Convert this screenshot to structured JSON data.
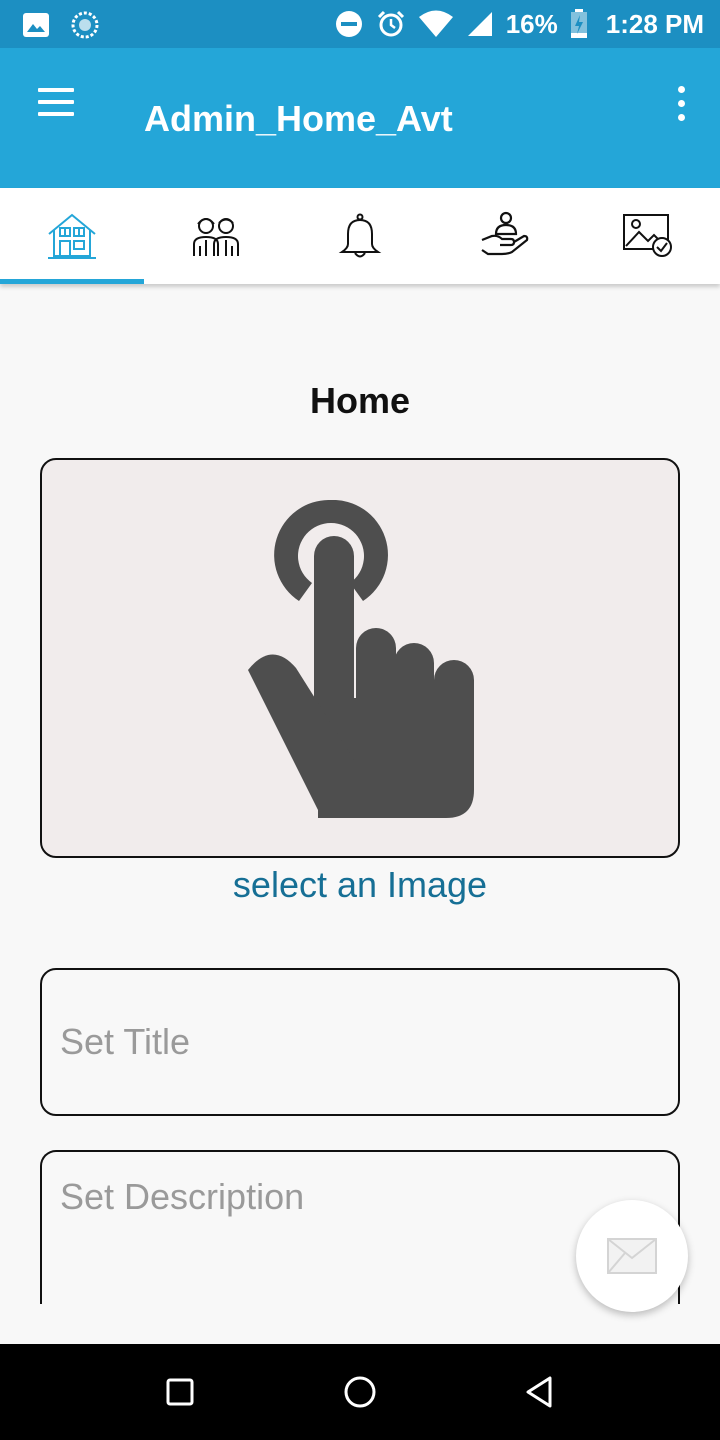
{
  "status_bar": {
    "battery": "16%",
    "time": "1:28 PM",
    "icons": [
      "gallery-notification-icon",
      "sync-notification-icon",
      "do-not-disturb-icon",
      "alarm-icon",
      "wifi-icon",
      "cell-signal-icon",
      "battery-charging-icon"
    ]
  },
  "app_bar": {
    "title": "Admin_Home_Avt",
    "menu_icon": "hamburger-menu-icon",
    "overflow_icon": "more-vert-icon"
  },
  "tabs": [
    {
      "icon": "house-icon",
      "active": true
    },
    {
      "icon": "people-icon",
      "active": false
    },
    {
      "icon": "bell-icon",
      "active": false
    },
    {
      "icon": "charity-hand-icon",
      "active": false
    },
    {
      "icon": "gallery-check-icon",
      "active": false
    }
  ],
  "main": {
    "heading": "Home",
    "image_picker_icon": "tap-hand-icon",
    "select_image_label": "select an Image",
    "title_placeholder": "Set Title",
    "description_placeholder": "Set Description"
  },
  "fab": {
    "icon": "envelope-icon"
  },
  "nav_bar": {
    "icons": [
      "recents-square-icon",
      "home-circle-icon",
      "back-triangle-icon"
    ]
  },
  "colors": {
    "status_bar": "#1c8fc2",
    "app_bar": "#24a6d8",
    "accent": "#24a6d8",
    "link": "#166f95",
    "picker_bg": "#f1ecec"
  }
}
